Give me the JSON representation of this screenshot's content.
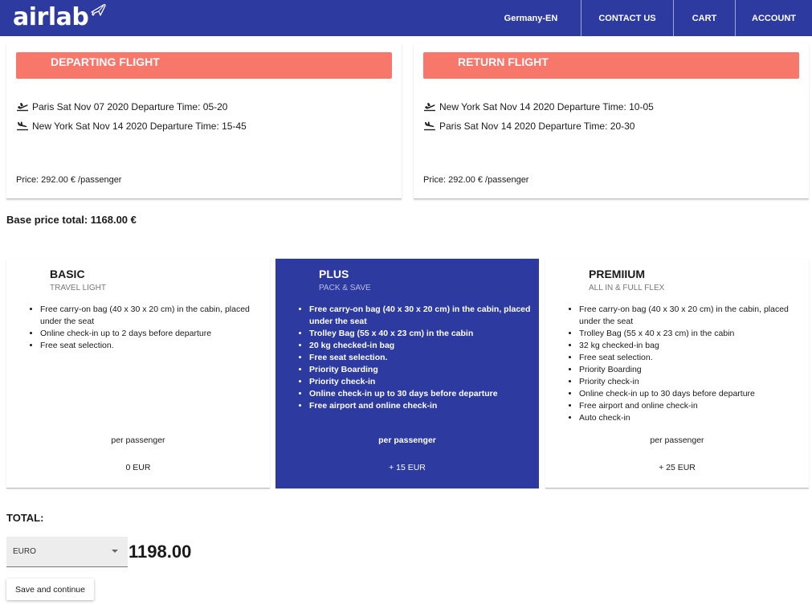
{
  "brand": {
    "name": "airlab",
    "color": "#2d3a9f",
    "accent": "#f7776a"
  },
  "nav": {
    "locale": "Germany-EN",
    "contact": "CONTACT US",
    "cart": "CART",
    "account": "ACCOUNT"
  },
  "departing": {
    "title": "DEPARTING FLIGHT",
    "legs": [
      {
        "icon": "plane-departure-icon",
        "text": "Paris Sat Nov 07 2020 Departure Time: 05-20"
      },
      {
        "icon": "plane-arrival-icon",
        "text": "New York Sat Nov 14 2020 Departure Time: 15-45"
      }
    ],
    "price": "Price: 292.00 € /passenger"
  },
  "return": {
    "title": "RETURN FLIGHT",
    "legs": [
      {
        "icon": "plane-departure-icon",
        "text": "New York Sat Nov 14 2020 Departure Time: 10-05"
      },
      {
        "icon": "plane-arrival-icon",
        "text": "Paris Sat Nov 14 2020 Departure Time: 20-30"
      }
    ],
    "price": "Price: 292.00 € /passenger"
  },
  "base_total": "Base price total: 1168.00 €",
  "plans": [
    {
      "name": "BASIC",
      "subtitle": "TRAVEL LIGHT",
      "features": [
        "Free carry-on bag (40 x 30 x 20 cm) in the cabin, placed under the seat",
        "Online check-in up to 2 days before departure",
        "Free seat selection."
      ],
      "per": "per passenger",
      "price": "0 EUR"
    },
    {
      "name": "PLUS",
      "subtitle": "PACK & SAVE",
      "features": [
        "Free carry-on bag (40 x 30 x 20 cm) in the cabin, placed under the seat",
        "Trolley Bag (55 x 40 x 23 cm) in the cabin",
        "20 kg checked-in bag",
        "Free seat selection.",
        "Priority Boarding",
        "Priority check-in",
        "Online check-in up to 30 days before departure",
        "Free airport and online check-in"
      ],
      "per": "per passenger",
      "price": "+ 15 EUR"
    },
    {
      "name": "PREMIIUM",
      "subtitle": "ALL IN & FULL FLEX",
      "features": [
        "Free carry-on bag (40 x 30 x 20 cm) in the cabin, placed under the seat",
        "Trolley Bag (55 x 40 x 23 cm) in the cabin",
        "32 kg checked-in bag",
        "Free seat selection.",
        "Priority Boarding",
        "Priority check-in",
        "Online check-in up to 30 days before departure",
        "Free airport and online check-in",
        "Auto check-in"
      ],
      "per": "per passenger",
      "price": "+ 25 EUR"
    }
  ],
  "selected_plan": "PLUS",
  "total": {
    "label": "TOTAL:",
    "currency": "EURO",
    "amount": "1198.00"
  },
  "save_label": "Save and continue"
}
